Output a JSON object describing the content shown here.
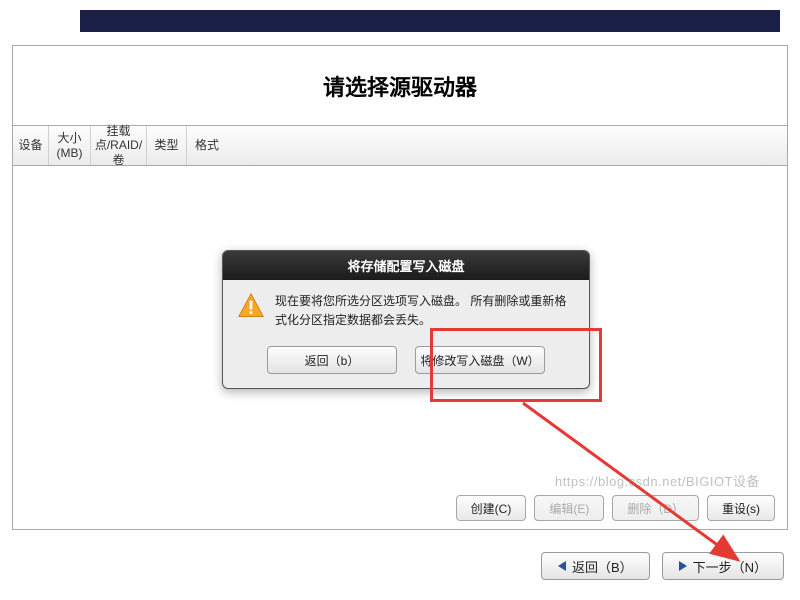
{
  "header": {
    "title": "请选择源驱动器"
  },
  "table": {
    "columns": [
      "设备",
      "大小(MB)",
      "挂载点/RAID/卷",
      "类型",
      "格式"
    ]
  },
  "actions": {
    "create": "创建(C)",
    "edit": "编辑(E)",
    "delete": "删除（D）",
    "reset": "重设(s)"
  },
  "footer": {
    "back": "返回（B）",
    "next": "下一步（N）"
  },
  "dialog": {
    "title": "将存储配置写入磁盘",
    "message_line1": "现在要将您所选分区选项写入磁盘。 所有删除或重新格",
    "message_line2": "式化分区指定数据都会丢失。",
    "back_btn": "返回（b）",
    "write_btn": "将修改写入磁盘（W）"
  },
  "watermark": "https://blog.csdn.net/BIGIOT设备"
}
